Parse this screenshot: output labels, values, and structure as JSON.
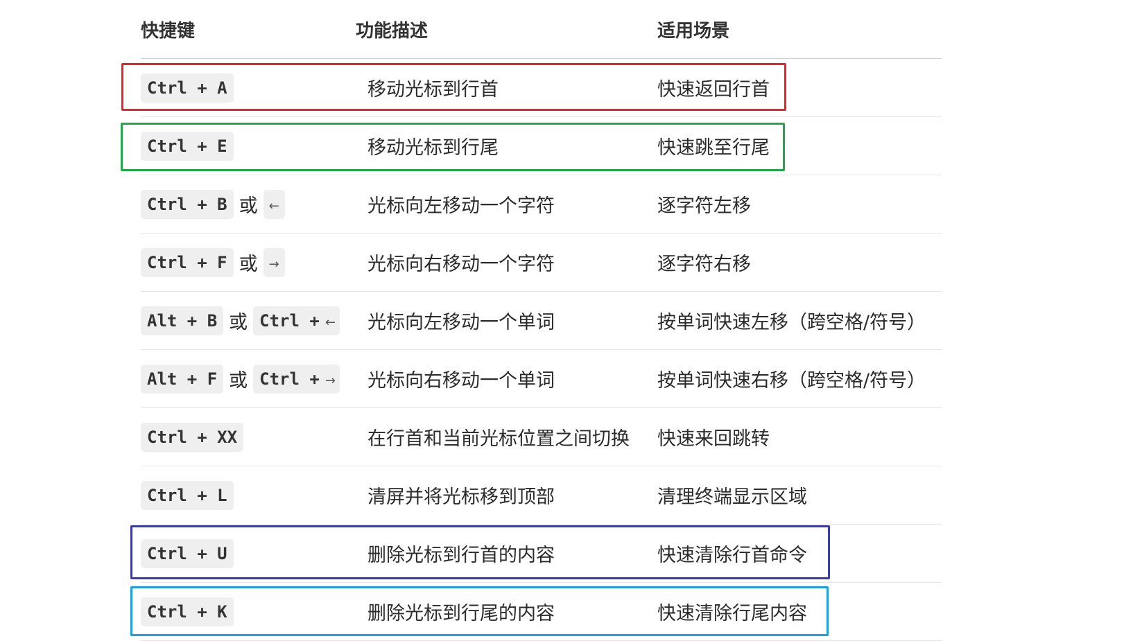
{
  "headers": [
    "快捷键",
    "功能描述",
    "适用场景"
  ],
  "rows": [
    {
      "keys": "Ctrl + A",
      "desc": "移动光标到行首",
      "scene": "快速返回行首"
    },
    {
      "keys": "Ctrl + E",
      "desc": "移动光标到行尾",
      "scene": "快速跳至行尾"
    },
    {
      "keys": "Ctrl + B",
      "or": "或",
      "alt_key": "←",
      "desc": "光标向左移动一个字符",
      "scene": "逐字符左移"
    },
    {
      "keys": "Ctrl + F",
      "or": "或",
      "alt_key": "→",
      "desc": "光标向右移动一个字符",
      "scene": "逐字符右移"
    },
    {
      "keys": "Alt + B",
      "or": "或",
      "alt_key_text": "Ctrl +",
      "alt_key_arrow": "←",
      "desc": "光标向左移动一个单词",
      "scene": "按单词快速左移（跨空格/符号）"
    },
    {
      "keys": "Alt + F",
      "or": "或",
      "alt_key_text": "Ctrl +",
      "alt_key_arrow": "→",
      "desc": "光标向右移动一个单词",
      "scene": "按单词快速右移（跨空格/符号）"
    },
    {
      "keys": "Ctrl + XX",
      "desc": "在行首和当前光标位置之间切换",
      "scene": "快速来回跳转"
    },
    {
      "keys": "Ctrl + L",
      "desc": "清屏并将光标移到顶部",
      "scene": "清理终端显示区域"
    },
    {
      "keys": "Ctrl + U",
      "desc": "删除光标到行首的内容",
      "scene": "快速清除行首命令"
    },
    {
      "keys": "Ctrl + K",
      "desc": "删除光标到行尾的内容",
      "scene": "快速清除行尾内容"
    }
  ],
  "highlight_colors": {
    "ctrl_a": "#e8232b",
    "ctrl_e": "#22a84a",
    "ctrl_u": "#3a3aa8",
    "ctrl_k": "#1ba0e0"
  }
}
